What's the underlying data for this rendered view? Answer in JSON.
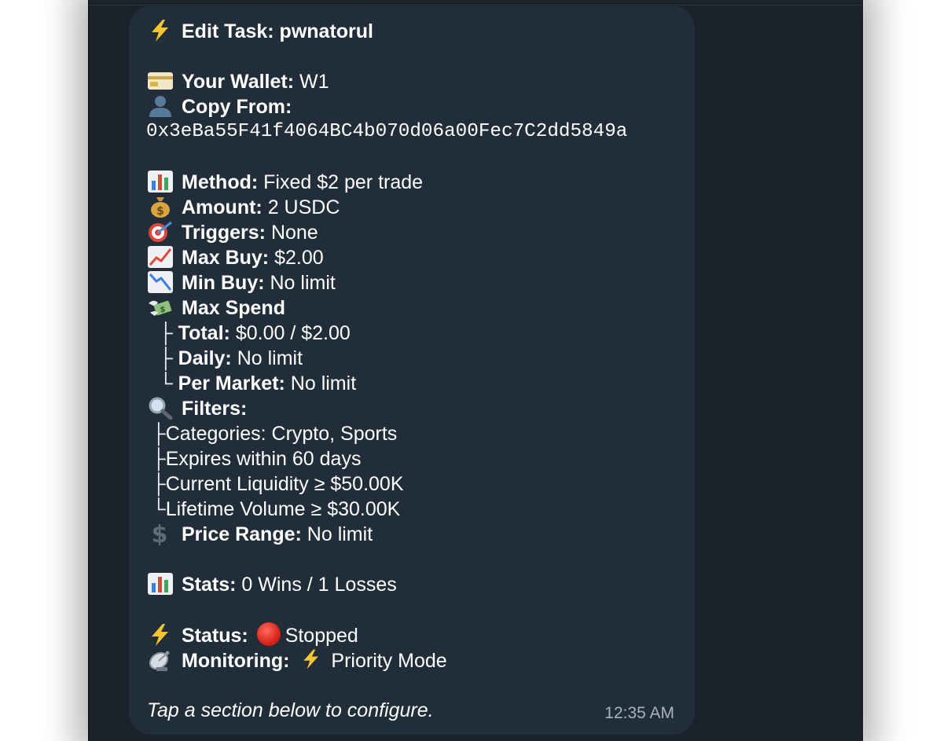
{
  "message": {
    "title_label": "Edit Task: pwnatorul",
    "wallet": {
      "label": "Your Wallet:",
      "value": "W1"
    },
    "copy_from": {
      "label": "Copy From:",
      "value": "0x3eBa55F41f4064BC4b070d06a00Fec7C2dd5849a"
    },
    "method": {
      "label": "Method:",
      "value": "Fixed $2 per trade"
    },
    "amount": {
      "label": "Amount:",
      "value": "2 USDC"
    },
    "triggers": {
      "label": "Triggers:",
      "value": "None"
    },
    "max_buy": {
      "label": "Max Buy:",
      "value": "$2.00"
    },
    "min_buy": {
      "label": "Min Buy:",
      "value": "No limit"
    },
    "max_spend": {
      "label": "Max Spend",
      "total": {
        "tree": "├",
        "label": "Total:",
        "value": "$0.00 / $2.00"
      },
      "daily": {
        "tree": "├",
        "label": "Daily:",
        "value": "No limit"
      },
      "per_market": {
        "tree": "└",
        "label": "Per Market:",
        "value": "No limit"
      }
    },
    "filters": {
      "label": "Filters:",
      "items": [
        {
          "tree": "├",
          "text": "Categories: Crypto, Sports"
        },
        {
          "tree": "├",
          "text": "Expires within 60 days"
        },
        {
          "tree": "├",
          "text": "Current Liquidity ≥ $50.00K"
        },
        {
          "tree": "└",
          "text": "Lifetime Volume ≥ $30.00K"
        }
      ]
    },
    "price_range": {
      "label": "Price Range:",
      "value": "No limit"
    },
    "stats": {
      "label": "Stats:",
      "value": "0 Wins / 1 Losses"
    },
    "status": {
      "label": "Status:",
      "value": "Stopped",
      "color": "#e0271f"
    },
    "monitoring": {
      "label": "Monitoring:",
      "value": "Priority Mode"
    },
    "footer_hint": "Tap a section below to configure.",
    "timestamp": "12:35 AM"
  },
  "colors": {
    "background": "#1b222b",
    "bubble": "#222d3a",
    "text": "#ffffff",
    "timestamp": "#a9b3bf",
    "bolt": "#f7c530"
  },
  "icons": {
    "title": "lightning-icon",
    "wallet": "credit-card-icon",
    "copy_from": "person-silhouette-icon",
    "method": "bar-chart-icon",
    "amount": "money-bag-icon",
    "triggers": "target-dart-icon",
    "max_buy": "chart-increasing-icon",
    "min_buy": "chart-decreasing-icon",
    "max_spend": "money-with-wings-icon",
    "filters": "magnifying-glass-icon",
    "price_range": "dollar-sign-icon",
    "stats": "bar-chart-icon",
    "status": "lightning-icon",
    "monitoring": "satellite-antenna-icon"
  }
}
